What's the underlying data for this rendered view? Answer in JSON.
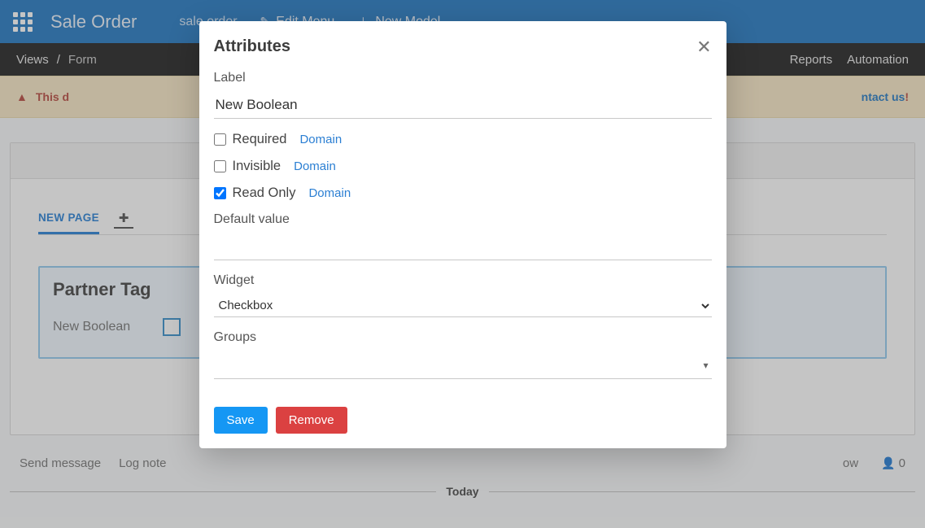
{
  "topbar": {
    "title": "Sale Order",
    "model": "sale.order",
    "edit_menu": "Edit Menu",
    "new_model": "New Model"
  },
  "subbar": {
    "views": "Views",
    "form": "Form",
    "reports": "Reports",
    "automation": "Automation"
  },
  "banner": {
    "prefix": "This d",
    "contact": "ntact us",
    "excl": " !"
  },
  "tabs": {
    "new_page": "NEW PAGE"
  },
  "partner": {
    "title": "Partner Tag",
    "field_label": "New Boolean"
  },
  "chatter": {
    "send": "Send message",
    "log": "Log note",
    "follow_suffix": "ow",
    "followers": "0",
    "today": "Today"
  },
  "modal": {
    "title": "Attributes",
    "label_lbl": "Label",
    "label_value": "New Boolean",
    "required": "Required",
    "invisible": "Invisible",
    "readonly": "Read Only",
    "domain": "Domain",
    "default_value_lbl": "Default value",
    "default_value": "",
    "widget_lbl": "Widget",
    "widget_value": "Checkbox",
    "groups_lbl": "Groups",
    "save": "Save",
    "remove": "Remove"
  }
}
